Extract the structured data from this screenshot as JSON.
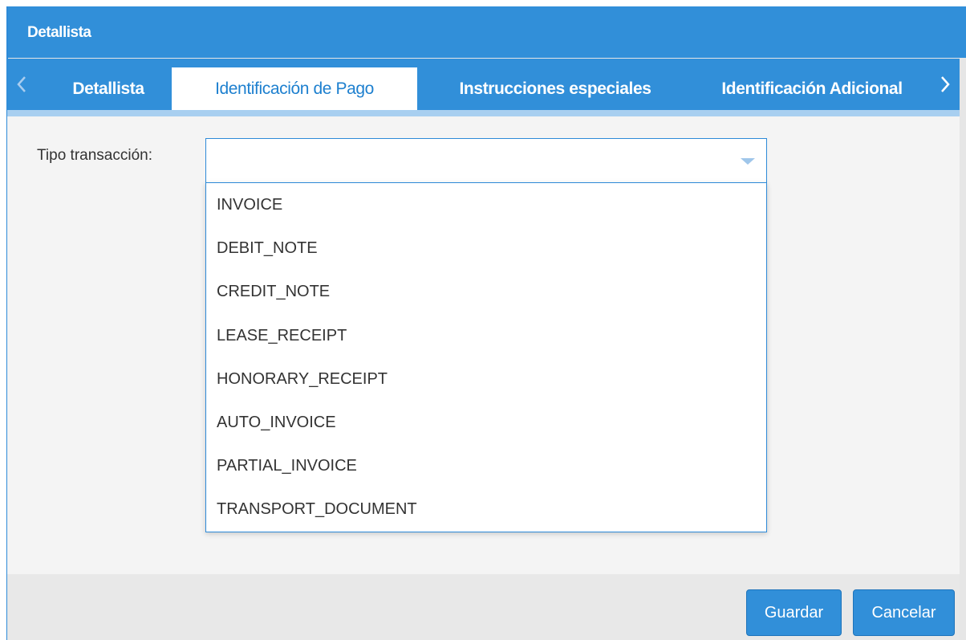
{
  "window": {
    "title": "Detallista"
  },
  "tabs": [
    {
      "label": "Detallista",
      "active": false
    },
    {
      "label": "Identificación de Pago",
      "active": true
    },
    {
      "label": "Instrucciones especiales",
      "active": false
    },
    {
      "label": "Identificación Adicional",
      "active": false
    }
  ],
  "form": {
    "tipo_transaccion": {
      "label": "Tipo transacción:",
      "value": "",
      "options": [
        "INVOICE",
        "DEBIT_NOTE",
        "CREDIT_NOTE",
        "LEASE_RECEIPT",
        "HONORARY_RECEIPT",
        "AUTO_INVOICE",
        "PARTIAL_INVOICE",
        "TRANSPORT_DOCUMENT"
      ]
    }
  },
  "buttons": {
    "save": "Guardar",
    "cancel": "Cancelar"
  },
  "colors": {
    "accent": "#318fd9",
    "tab_active_text": "#1e80cf",
    "content_bg": "#f4f4f4"
  }
}
